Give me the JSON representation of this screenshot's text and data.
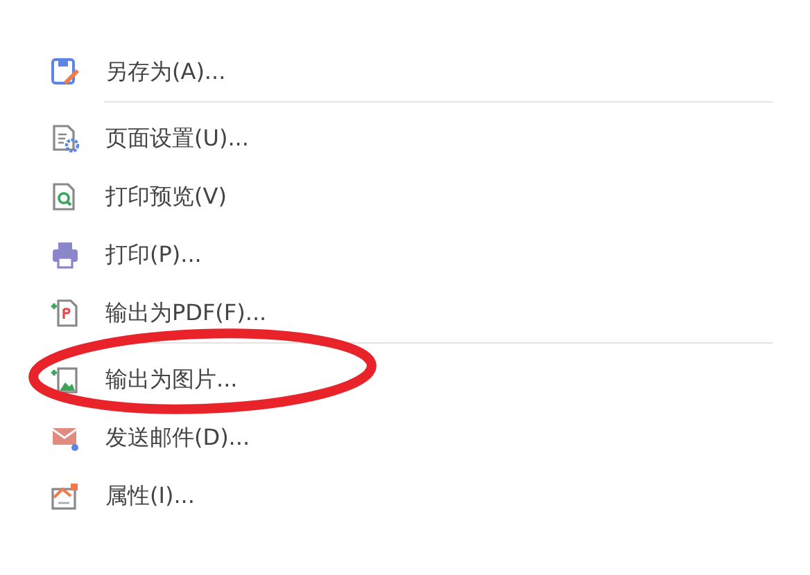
{
  "menu": {
    "items": [
      {
        "kind": "item",
        "label": "另存为(A)..."
      },
      {
        "kind": "separator"
      },
      {
        "kind": "item",
        "label": "页面设置(U)..."
      },
      {
        "kind": "item",
        "label": "打印预览(V)"
      },
      {
        "kind": "item",
        "label": "打印(P)..."
      },
      {
        "kind": "item",
        "label": "输出为PDF(F)..."
      },
      {
        "kind": "separator"
      },
      {
        "kind": "item",
        "label": "输出为图片..."
      },
      {
        "kind": "item",
        "label": "发送邮件(D)..."
      },
      {
        "kind": "item",
        "label": "属性(I)..."
      }
    ]
  },
  "annotation": {
    "kind": "ellipse",
    "color": "#e8232a"
  }
}
